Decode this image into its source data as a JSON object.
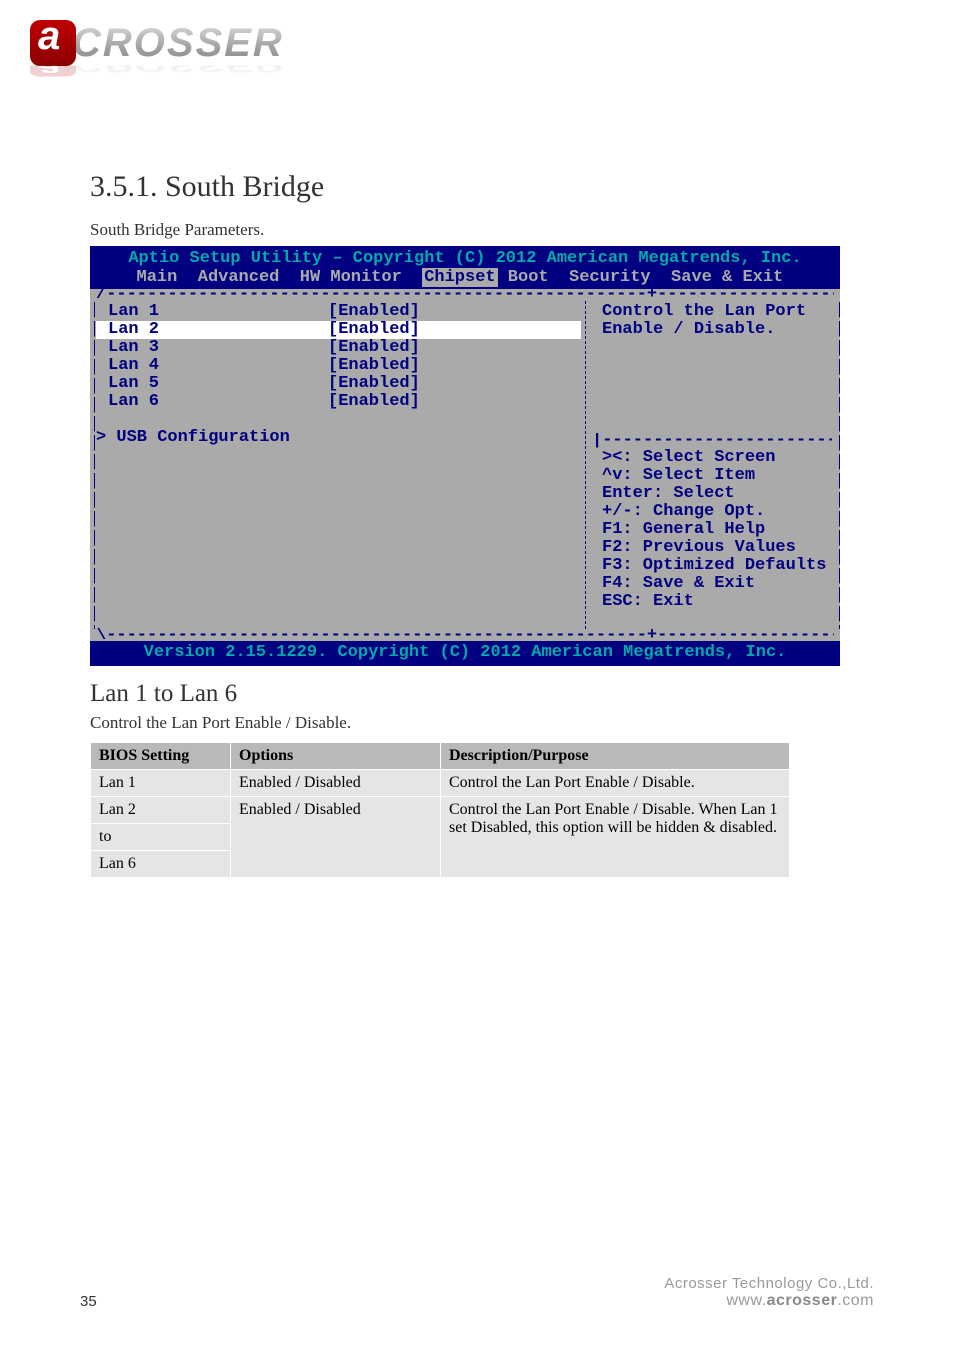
{
  "logo": {
    "text": "CROSSER"
  },
  "page": {
    "title": "3.5.1. South Bridge",
    "intro": "South Bridge Parameters.",
    "lan_heading": "Lan 1 to Lan 6",
    "lan_desc": "Control the Lan Port Enable / Disable."
  },
  "bios": {
    "header_title": "Aptio Setup Utility – Copyright (C) 2012 American Megatrends, Inc.",
    "menus": [
      "Main",
      "Advanced",
      "HW Monitor",
      "Chipset",
      "Boot",
      "Security",
      "Save & Exit"
    ],
    "selected_menu": "Chipset",
    "items": [
      {
        "label": "Lan 1",
        "value": "[Enabled]",
        "selected": false
      },
      {
        "label": "Lan 2",
        "value": "[Enabled]",
        "selected": true
      },
      {
        "label": "Lan 3",
        "value": "[Enabled]",
        "selected": false
      },
      {
        "label": "Lan 4",
        "value": "[Enabled]",
        "selected": false
      },
      {
        "label": "Lan 5",
        "value": "[Enabled]",
        "selected": false
      },
      {
        "label": "Lan 6",
        "value": "[Enabled]",
        "selected": false
      }
    ],
    "submenu": "USB Configuration",
    "help_desc": "Control the Lan Port Enable / Disable.",
    "keys": [
      "><: Select Screen",
      "^v: Select Item",
      "Enter: Select",
      "+/-: Change Opt.",
      "F1: General Help",
      "F2: Previous Values",
      "F3: Optimized Defaults",
      "F4: Save & Exit",
      "ESC: Exit"
    ],
    "footer": "Version 2.15.1229. Copyright (C) 2012 American Megatrends, Inc."
  },
  "table": {
    "headers": [
      "BIOS Setting",
      "Options",
      "Description/Purpose"
    ],
    "rows": [
      {
        "setting": "Lan 1",
        "options": "Enabled / Disabled",
        "desc": "Control the Lan Port Enable / Disable."
      },
      {
        "setting": "Lan 2\nto\nLan 6",
        "options": "Enabled / Disabled",
        "desc": "Control the Lan Port Enable / Disable. When Lan 1 set Disabled, this option will be hidden & disabled."
      }
    ]
  },
  "footer": {
    "company": "Acrosser Technology Co.,Ltd.",
    "url_pre": "www.",
    "url_bold": "acrosser",
    "url_post": ".com"
  },
  "pagenum": "35"
}
